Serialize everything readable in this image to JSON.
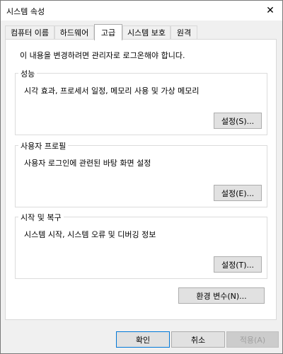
{
  "window": {
    "title": "시스템 속성",
    "close_glyph": "✕"
  },
  "tabs": [
    {
      "label": "컴퓨터 이름"
    },
    {
      "label": "하드웨어"
    },
    {
      "label": "고급"
    },
    {
      "label": "시스템 보호"
    },
    {
      "label": "원격"
    }
  ],
  "active_tab": "고급",
  "notice": "이 내용을 변경하려면 관리자로 로그온해야 합니다.",
  "groups": {
    "performance": {
      "title": "성능",
      "description": "시각 효과, 프로세서 일정, 메모리 사용 및 가상 메모리",
      "button": "설정(S)..."
    },
    "user_profiles": {
      "title": "사용자 프로필",
      "description": "사용자 로그인에 관련된 바탕 화면 설정",
      "button": "설정(E)..."
    },
    "startup_recovery": {
      "title": "시작 및 복구",
      "description": "시스템 시작, 시스템 오류 및 디버깅 정보",
      "button": "설정(T)..."
    }
  },
  "env_button": "환경 변수(N)...",
  "footer": {
    "ok": "확인",
    "cancel": "취소",
    "apply": "적용(A)"
  },
  "icons": {
    "close": "close-icon"
  }
}
